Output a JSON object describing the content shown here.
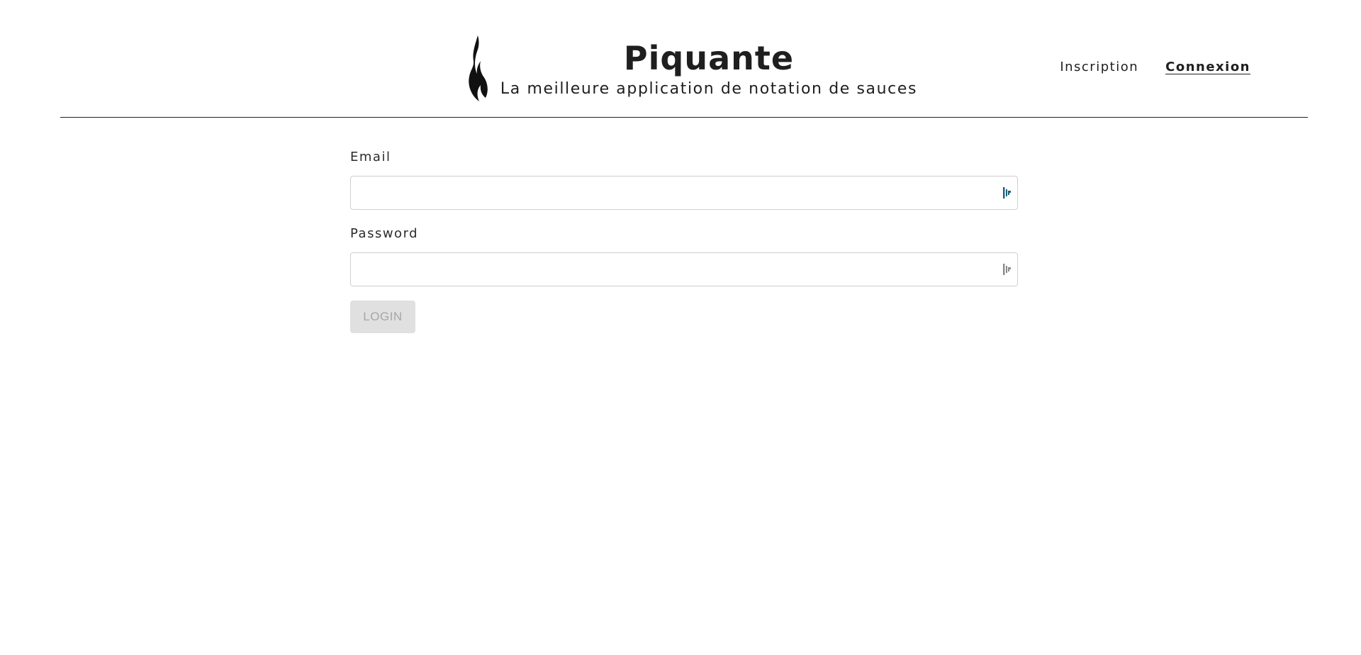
{
  "header": {
    "title": "Piquante",
    "subtitle": "La meilleure application de notation de sauces",
    "logo_icon": "flame-icon"
  },
  "nav": {
    "items": [
      {
        "label": "Inscription",
        "active": false
      },
      {
        "label": "Connexion",
        "active": true
      }
    ]
  },
  "form": {
    "email": {
      "label": "Email",
      "value": "",
      "placeholder": "",
      "icon": "password-manager-icon"
    },
    "password": {
      "label": "Password",
      "value": "",
      "placeholder": "",
      "icon": "password-manager-icon"
    },
    "submit_label": "LOGIN",
    "submit_enabled": false
  },
  "colors": {
    "text": "#1f1f1f",
    "rule": "#1f1f1f",
    "input_border": "#cfcfcf",
    "button_bg_disabled": "#e0e0e0",
    "button_text_disabled": "#a6a6a6",
    "pm_icon_active": "#1b5e7a",
    "pm_icon_inactive": "#8a8a8a"
  }
}
